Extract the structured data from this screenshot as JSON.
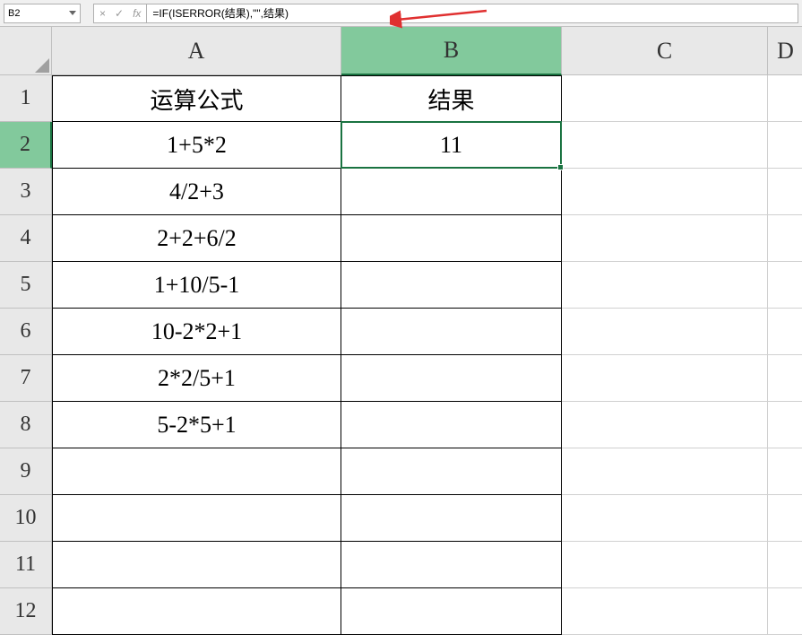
{
  "name_box": {
    "value": "B2"
  },
  "formula_bar": {
    "cancel_symbol": "×",
    "enter_symbol": "✓",
    "fx_label": "fx",
    "formula": "=IF(ISERROR(结果),\"\",结果)"
  },
  "columns": [
    "A",
    "B",
    "C",
    "D"
  ],
  "rows": [
    "1",
    "2",
    "3",
    "4",
    "5",
    "6",
    "7",
    "8",
    "9",
    "10",
    "11",
    "12"
  ],
  "active_cell": "B2",
  "selected_row": 2,
  "selected_col": "B",
  "table": {
    "headers": {
      "a1": "运算公式",
      "b1": "结果"
    },
    "data": [
      {
        "formula": "1+5*2",
        "result": "11"
      },
      {
        "formula": "4/2+3",
        "result": ""
      },
      {
        "formula": "2+2+6/2",
        "result": ""
      },
      {
        "formula": "1+10/5-1",
        "result": ""
      },
      {
        "formula": "10-2*2+1",
        "result": ""
      },
      {
        "formula": "2*2/5+1",
        "result": ""
      },
      {
        "formula": "5-2*5+1",
        "result": ""
      },
      {
        "formula": "",
        "result": ""
      },
      {
        "formula": "",
        "result": ""
      },
      {
        "formula": "",
        "result": ""
      },
      {
        "formula": "",
        "result": ""
      }
    ]
  }
}
